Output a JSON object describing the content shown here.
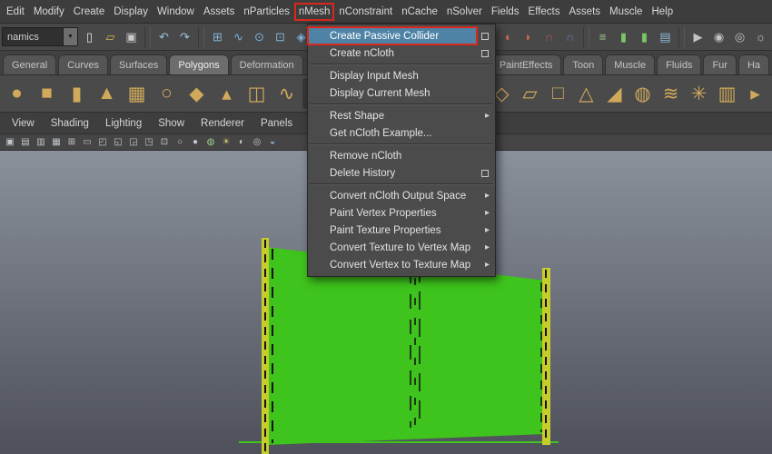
{
  "colors": {
    "highlight_red": "#d8281e",
    "menu_highlight_blue": "#4f83a6",
    "cloth_green": "#3ec41c",
    "pole_yellow": "#c6cc2a",
    "viewport_top": "#8a919b",
    "viewport_bottom": "#4e505a"
  },
  "glyphs": {
    "dropdown_arrow": "▼",
    "submenu_arrow": "▸"
  },
  "menu_bar": {
    "items": [
      "Edit",
      "Modify",
      "Create",
      "Display",
      "Window",
      "Assets",
      "nParticles",
      "nMesh",
      "nConstraint",
      "nCache",
      "nSolver",
      "Fields",
      "Effects",
      "Assets",
      "Muscle",
      "Help"
    ],
    "highlighted_item": "nMesh"
  },
  "status_line": {
    "menu_set": "namics",
    "left_icons": [
      {
        "name": "new-scene",
        "glyph": "▯",
        "color": "#e2e2e2"
      },
      {
        "name": "open-scene",
        "glyph": "▱",
        "color": "#d8b44a"
      },
      {
        "name": "save-scene",
        "glyph": "▣",
        "color": "#c9c9c9"
      },
      {
        "name": "divider",
        "divider": true
      },
      {
        "name": "undo",
        "glyph": "↶",
        "color": "#9fc3de"
      },
      {
        "name": "redo",
        "glyph": "↷",
        "color": "#9fc3de"
      },
      {
        "name": "divider",
        "divider": true
      },
      {
        "name": "snap-to-grid",
        "glyph": "⊞",
        "color": "#7fb2d9"
      },
      {
        "name": "snap-to-curve",
        "glyph": "∿",
        "color": "#7fb2d9"
      },
      {
        "name": "snap-to-point",
        "glyph": "⊙",
        "color": "#7fb2d9"
      },
      {
        "name": "snap-to-view-plane",
        "glyph": "⊡",
        "color": "#7fb2d9"
      },
      {
        "name": "make-live",
        "glyph": "◈",
        "color": "#7fb2d9"
      }
    ],
    "right_icons": [
      {
        "name": "input-connection",
        "glyph": "◖",
        "color": "#d06a50"
      },
      {
        "name": "output-connection",
        "glyph": "◗",
        "color": "#d06a50"
      },
      {
        "name": "magnet-snap-a",
        "glyph": "∩",
        "color": "#c05454"
      },
      {
        "name": "magnet-snap-b",
        "glyph": "∩",
        "color": "#5f7fb8"
      },
      {
        "name": "divider",
        "divider": true
      },
      {
        "name": "construction-history",
        "glyph": "≡",
        "color": "#9fc48f"
      },
      {
        "name": "green-toggle-1",
        "glyph": "▮",
        "color": "#7cc46a"
      },
      {
        "name": "green-toggle-2",
        "glyph": "▮",
        "color": "#7cc46a"
      },
      {
        "name": "highlight-panel",
        "glyph": "▤",
        "color": "#8fb9d4"
      },
      {
        "name": "divider",
        "divider": true
      },
      {
        "name": "render-view",
        "glyph": "▶",
        "color": "#c2c2c2"
      },
      {
        "name": "render-current-frame",
        "glyph": "◉",
        "color": "#c2c2c2"
      },
      {
        "name": "ipr-render",
        "glyph": "◎",
        "color": "#c2c2c2"
      },
      {
        "name": "render-settings",
        "glyph": "☼",
        "color": "#c2c2c2"
      }
    ]
  },
  "shelf": {
    "tabs": [
      "General",
      "Curves",
      "Surfaces",
      "Polygons",
      "Deformation",
      "PaintEffects",
      "Toon",
      "Muscle",
      "Fluids",
      "Fur",
      "Ha"
    ],
    "active_tab": "Polygons",
    "left_icons": [
      {
        "name": "poly-sphere",
        "glyph": "●",
        "color": "#d0a95a"
      },
      {
        "name": "poly-cube",
        "glyph": "■",
        "color": "#d0a95a"
      },
      {
        "name": "poly-cylinder",
        "glyph": "▮",
        "color": "#d0a95a"
      },
      {
        "name": "poly-cone",
        "glyph": "▲",
        "color": "#d0a95a"
      },
      {
        "name": "poly-plane",
        "glyph": "▦",
        "color": "#d0a95a"
      },
      {
        "name": "poly-torus",
        "glyph": "○",
        "color": "#d0a95a"
      },
      {
        "name": "poly-prism",
        "glyph": "◆",
        "color": "#d0a95a"
      },
      {
        "name": "poly-pyramid",
        "glyph": "▴",
        "color": "#d0a95a"
      },
      {
        "name": "poly-pipe",
        "glyph": "◫",
        "color": "#d0a95a"
      },
      {
        "name": "poly-helix",
        "glyph": "∿",
        "color": "#d0a95a"
      },
      {
        "name": "poly-soccer-ball",
        "glyph": "◉",
        "color": "#d0a95a",
        "bg": "#383838"
      }
    ],
    "right_icons": [
      {
        "name": "poly-platonic",
        "glyph": "◇",
        "color": "#d0a95a"
      },
      {
        "name": "poly-plane-2",
        "glyph": "▱",
        "color": "#d0a95a"
      },
      {
        "name": "poly-cube-2",
        "glyph": "□",
        "color": "#d0a95a"
      },
      {
        "name": "poly-cone-2",
        "glyph": "△",
        "color": "#d0a95a"
      },
      {
        "name": "poly-ramp",
        "glyph": "◢",
        "color": "#d0a95a"
      },
      {
        "name": "poly-sphere-2",
        "glyph": "◍",
        "color": "#d0a95a"
      },
      {
        "name": "poly-spring",
        "glyph": "≋",
        "color": "#d0a95a"
      },
      {
        "name": "poly-gear",
        "glyph": "✳",
        "color": "#d0a95a"
      },
      {
        "name": "poly-pipe-2",
        "glyph": "▥",
        "color": "#d0a95a"
      },
      {
        "name": "poly-arrow",
        "glyph": "▸",
        "color": "#d0a95a"
      }
    ]
  },
  "panel_menu": {
    "items": [
      "View",
      "Shading",
      "Lighting",
      "Show",
      "Renderer",
      "Panels"
    ]
  },
  "viewport": {
    "toolbar_icons": [
      {
        "name": "select-camera",
        "glyph": "▣",
        "color": "#c2c8ce"
      },
      {
        "name": "camera-attributes",
        "glyph": "▤",
        "color": "#c2c8ce"
      },
      {
        "name": "bookmarks",
        "glyph": "▥",
        "color": "#c2c8ce"
      },
      {
        "name": "image-plane",
        "glyph": "▦",
        "color": "#c2c8ce"
      },
      {
        "name": "grid",
        "glyph": "⊞",
        "color": "#c2c8ce"
      },
      {
        "name": "film-gate",
        "glyph": "▭",
        "color": "#c2c8ce"
      },
      {
        "name": "resolution-gate",
        "glyph": "◰",
        "color": "#c2c8ce"
      },
      {
        "name": "gate-mask",
        "glyph": "◱",
        "color": "#c2c8ce"
      },
      {
        "name": "field-chart",
        "glyph": "◲",
        "color": "#c2c8ce"
      },
      {
        "name": "safe-action",
        "glyph": "◳",
        "color": "#c2c8ce"
      },
      {
        "name": "safe-title",
        "glyph": "⊡",
        "color": "#c2c8ce"
      },
      {
        "name": "wireframe",
        "glyph": "○",
        "color": "#c2c8ce"
      },
      {
        "name": "shaded",
        "glyph": "●",
        "color": "#c2c8ce"
      },
      {
        "name": "textured",
        "glyph": "◍",
        "color": "#9fd08c"
      },
      {
        "name": "lights",
        "glyph": "☀",
        "color": "#d8c868"
      },
      {
        "name": "shadows",
        "glyph": "◐",
        "color": "#c2c8ce"
      },
      {
        "name": "screen-ao",
        "glyph": "◎",
        "color": "#c2c8ce"
      },
      {
        "name": "xray",
        "glyph": "◒",
        "color": "#8fb8d8"
      }
    ]
  },
  "nmesh_menu": {
    "items": [
      {
        "type": "item",
        "label": "Create Passive Collider",
        "option_box": true,
        "highlighted": true
      },
      {
        "type": "item",
        "label": "Create nCloth",
        "option_box": true
      },
      {
        "type": "separator"
      },
      {
        "type": "item",
        "label": "Display Input Mesh"
      },
      {
        "type": "item",
        "label": "Display Current Mesh"
      },
      {
        "type": "separator"
      },
      {
        "type": "item",
        "label": "Rest Shape",
        "submenu": true
      },
      {
        "type": "item",
        "label": "Get nCloth Example..."
      },
      {
        "type": "separator"
      },
      {
        "type": "item",
        "label": "Remove nCloth"
      },
      {
        "type": "item",
        "label": "Delete History",
        "option_box": true
      },
      {
        "type": "separator"
      },
      {
        "type": "item",
        "label": "Convert nCloth Output Space",
        "submenu": true
      },
      {
        "type": "item",
        "label": "Paint Vertex Properties",
        "submenu": true
      },
      {
        "type": "item",
        "label": "Paint Texture Properties",
        "submenu": true
      },
      {
        "type": "item",
        "label": "Convert Texture to Vertex Map",
        "submenu": true
      },
      {
        "type": "item",
        "label": "Convert Vertex to Texture Map",
        "submenu": true
      }
    ]
  }
}
